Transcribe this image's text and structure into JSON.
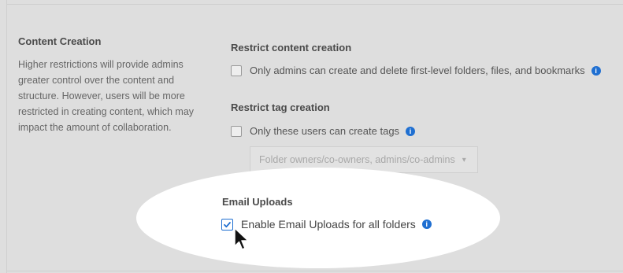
{
  "section": {
    "title": "Content Creation",
    "description": "Higher restrictions will provide admins greater control over the content and structure. However, users will be more restricted in creating content, which may impact the amount of collaboration."
  },
  "restrict_content": {
    "title": "Restrict content creation",
    "option_label": "Only admins can create and delete first-level folders, files, and bookmarks",
    "checked": false
  },
  "restrict_tags": {
    "title": "Restrict tag creation",
    "option_label": "Only these users can create tags",
    "checked": false,
    "select_value": "Folder owners/co-owners, admins/co-admins"
  },
  "email_uploads": {
    "title": "Email Uploads",
    "option_label": "Enable Email Uploads for all folders",
    "checked": true
  },
  "icons": {
    "info": "info-icon",
    "caret": "chevron-down-icon",
    "cursor": "mouse-pointer-icon"
  },
  "colors": {
    "accent": "#1f6fd1",
    "background": "#dedede",
    "spotlight": "#ffffff"
  }
}
